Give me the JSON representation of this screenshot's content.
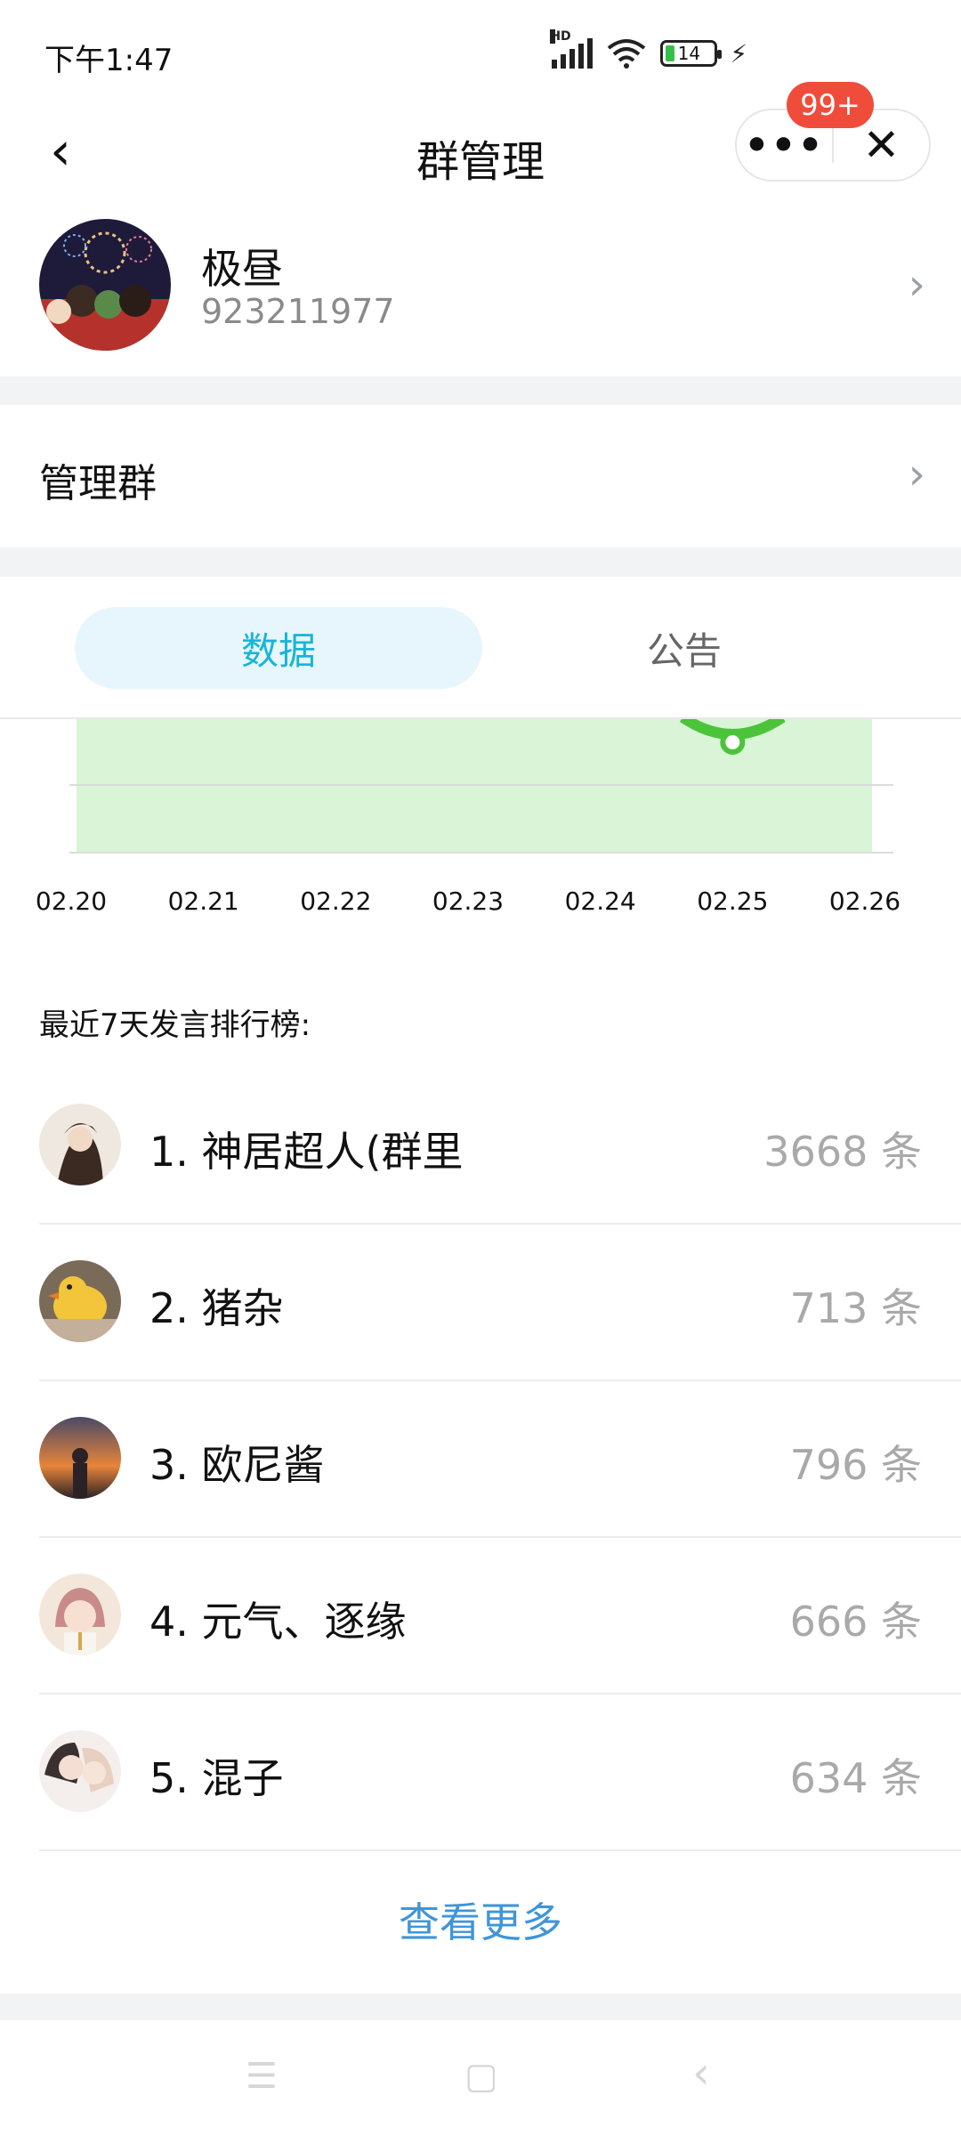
{
  "status_bar": {
    "time": "下午1:47",
    "hd_label": "HD",
    "battery_level": "14",
    "bolt": "⚡"
  },
  "nav": {
    "back_glyph": "‹",
    "title": "群管理",
    "more_glyph": "•••",
    "close_glyph": "✕",
    "badge": "99+"
  },
  "group": {
    "name": "极昼",
    "id": "923211977",
    "chevron": "›"
  },
  "manage": {
    "label": "管理群",
    "chevron": "›"
  },
  "tabs": [
    {
      "label": "数据",
      "active": true
    },
    {
      "label": "公告",
      "active": false
    }
  ],
  "chart_data": {
    "type": "area",
    "x": [
      "02.20",
      "02.21",
      "02.22",
      "02.23",
      "02.24",
      "02.25",
      "02.26"
    ],
    "fill_color": "#d9f4d6",
    "line_color": "#4bc43a",
    "grid": true
  },
  "ranking": {
    "title": "最近7天发言排行榜:",
    "items": [
      {
        "rank_name": "1. 神居超人(群里",
        "count": "3668 条"
      },
      {
        "rank_name": "2. 猪杂",
        "count": "713 条"
      },
      {
        "rank_name": "3. 欧尼酱",
        "count": "796 条"
      },
      {
        "rank_name": "4. 元气、逐缘",
        "count": "666 条"
      },
      {
        "rank_name": "5. 混子",
        "count": "634 条"
      }
    ],
    "view_more": "查看更多"
  },
  "system_nav": {
    "menu_glyph": "☰",
    "home_glyph": "▢",
    "back_glyph": "‹"
  }
}
